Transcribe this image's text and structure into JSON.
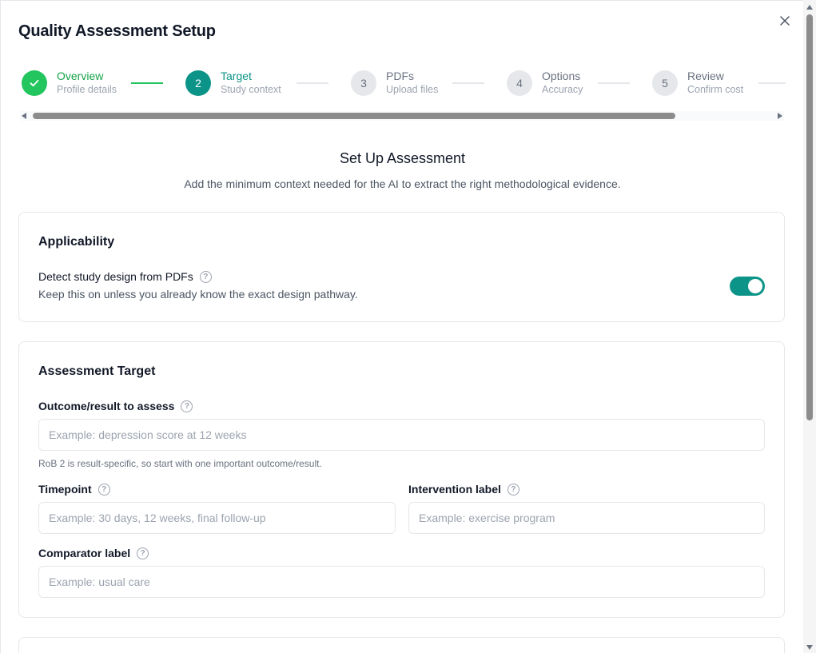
{
  "dialog": {
    "title": "Quality Assessment Setup",
    "close_icon": "close-icon"
  },
  "stepper": {
    "steps": [
      {
        "number": "",
        "label": "Overview",
        "sub": "Profile details",
        "state": "done"
      },
      {
        "number": "2",
        "label": "Target",
        "sub": "Study context",
        "state": "active"
      },
      {
        "number": "3",
        "label": "PDFs",
        "sub": "Upload files",
        "state": "pending"
      },
      {
        "number": "4",
        "label": "Options",
        "sub": "Accuracy",
        "state": "pending"
      },
      {
        "number": "5",
        "label": "Review",
        "sub": "Confirm cost",
        "state": "pending"
      }
    ]
  },
  "setup": {
    "title": "Set Up Assessment",
    "description": "Add the minimum context needed for the AI to extract the right methodological evidence."
  },
  "applicability": {
    "title": "Applicability",
    "detect_label": "Detect study design from PDFs",
    "detect_desc": "Keep this on unless you already know the exact design pathway.",
    "detect_enabled": true
  },
  "target": {
    "title": "Assessment Target",
    "outcome_label": "Outcome/result to assess",
    "outcome_placeholder": "Example: depression score at 12 weeks",
    "outcome_hint": "RoB 2 is result-specific, so start with one important outcome/result.",
    "timepoint_label": "Timepoint",
    "timepoint_placeholder": "Example: 30 days, 12 weeks, final follow-up",
    "intervention_label": "Intervention label",
    "intervention_placeholder": "Example: exercise program",
    "comparator_label": "Comparator label",
    "comparator_placeholder": "Example: usual care"
  },
  "colors": {
    "accent": "#0d9488",
    "done": "#22c55e",
    "pending": "#e5e7eb"
  }
}
